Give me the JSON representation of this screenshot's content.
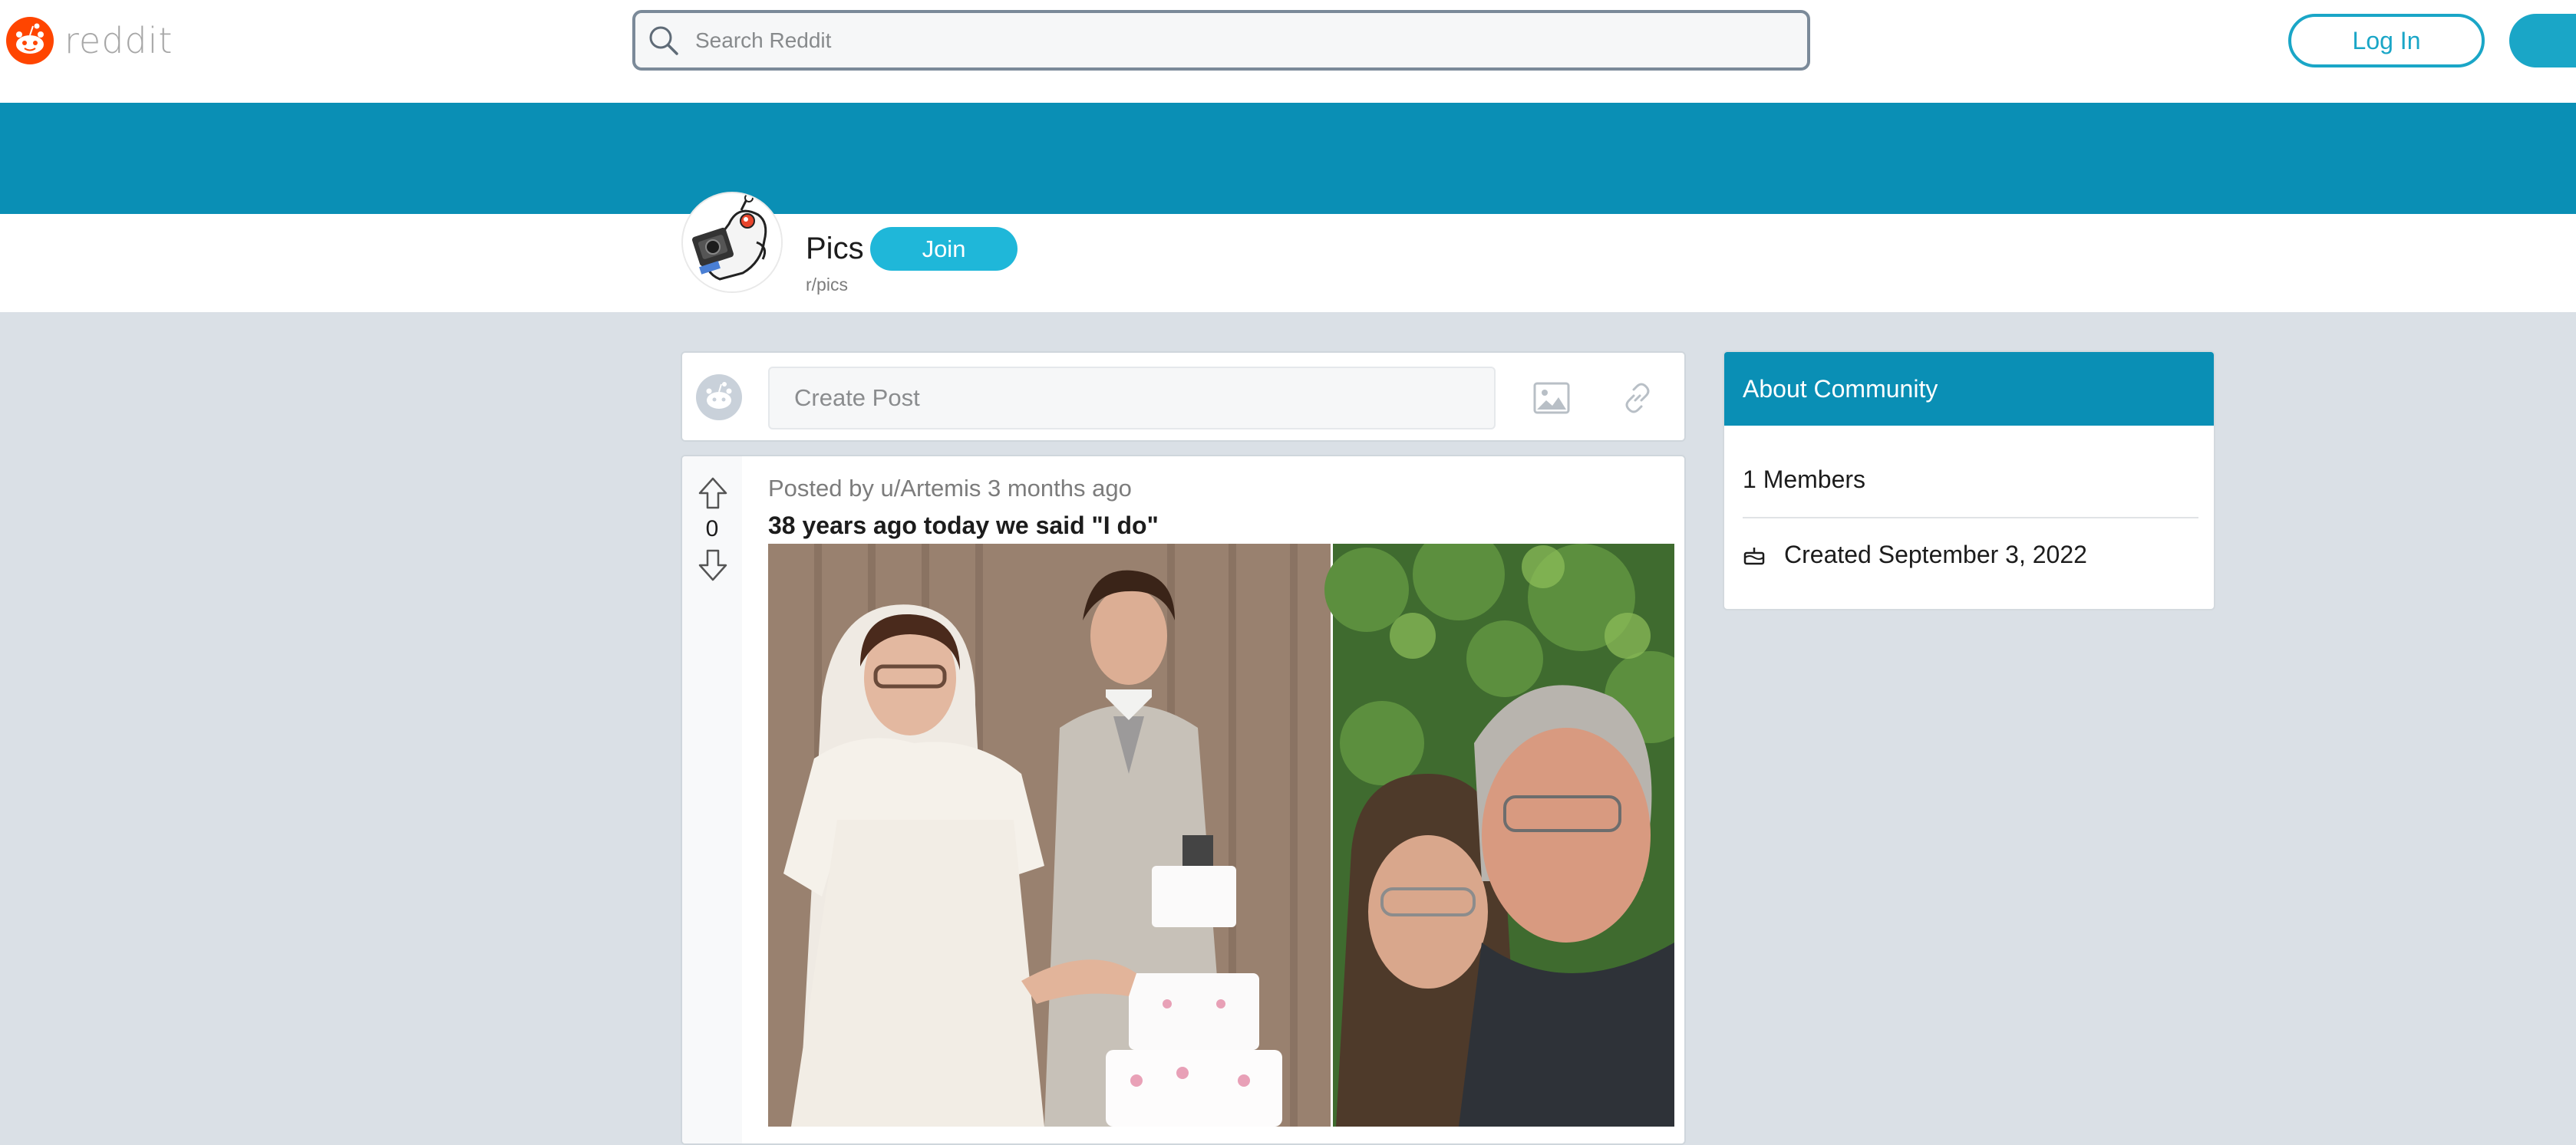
{
  "header": {
    "logo_text": "reddit",
    "search_placeholder": "Search Reddit",
    "login_label": "Log In",
    "brand_color": "#ff4500",
    "accent_color": "#1aa6c7"
  },
  "subreddit": {
    "title": "Pics",
    "name": "r/pics",
    "join_label": "Join",
    "banner_color": "#0a8fb5"
  },
  "create_post": {
    "placeholder": "Create Post",
    "icons": [
      "image-icon",
      "link-icon"
    ]
  },
  "post": {
    "meta": "Posted by u/Artemis 3 months ago",
    "title": "38 years ago today we said \"I do\"",
    "votes": "0"
  },
  "about": {
    "heading": "About Community",
    "members": "1 Members",
    "created": "Created September 3, 2022"
  }
}
